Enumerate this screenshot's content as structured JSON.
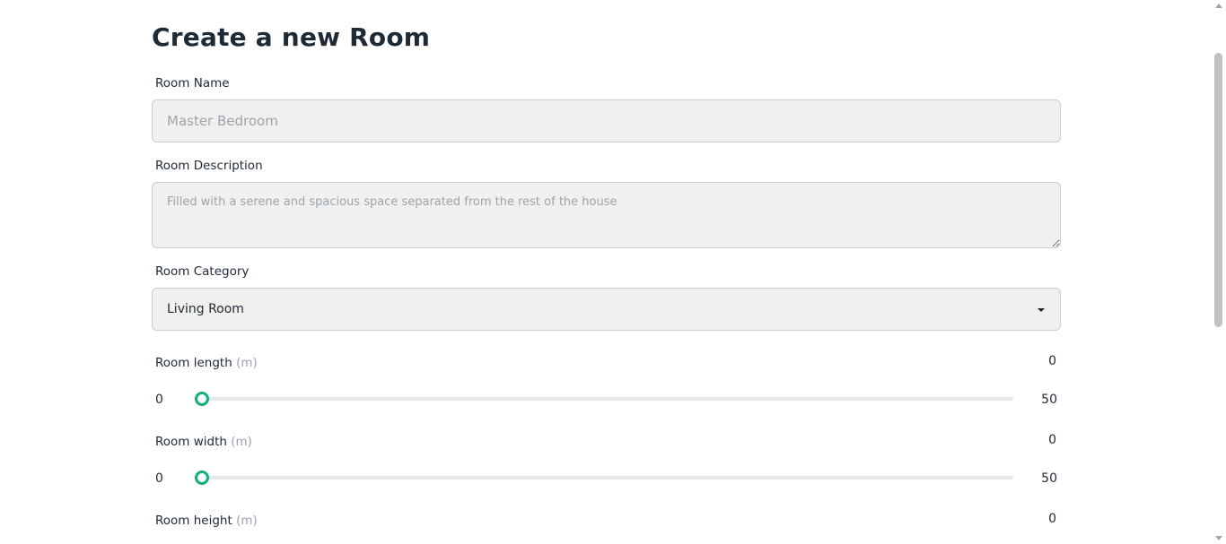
{
  "page": {
    "title": "Create a new Room"
  },
  "form": {
    "name": {
      "label": "Room Name",
      "placeholder": "Master Bedroom",
      "value": ""
    },
    "description": {
      "label": "Room Description",
      "placeholder": "Filled with a serene and spacious space separated from the rest of the house",
      "value": ""
    },
    "category": {
      "label": "Room Category",
      "selected": "Living Room"
    },
    "length": {
      "label": "Room length",
      "unit": "(m)",
      "value": "0",
      "min": "0",
      "max": "50",
      "fraction": 0
    },
    "width": {
      "label": "Room width",
      "unit": "(m)",
      "value": "0",
      "min": "0",
      "max": "50",
      "fraction": 0
    },
    "height": {
      "label": "Room height",
      "unit": "(m)",
      "value": "0"
    }
  },
  "colors": {
    "accent": "#10b07a",
    "input_bg": "#f0f1ee"
  },
  "icons": {
    "select_caret": "caret-down-icon",
    "scroll_up": "scroll-up-icon",
    "scroll_down": "scroll-down-icon"
  }
}
